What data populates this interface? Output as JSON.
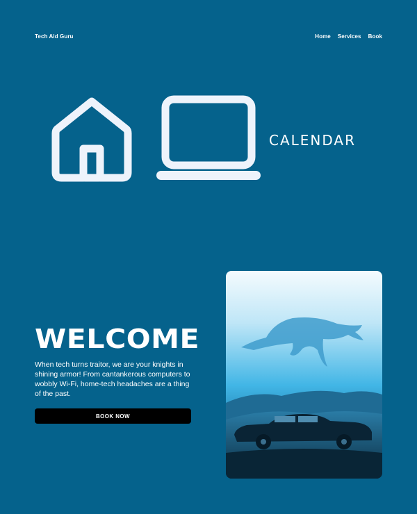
{
  "header": {
    "brand": "Tech Aid Guru",
    "nav": [
      "Home",
      "Services",
      "Book"
    ]
  },
  "icons": [
    "home-icon",
    "laptop-icon"
  ],
  "calendar_label": "CALENDAR",
  "hero": {
    "title": "WELCOME",
    "text": "When tech turns traitor, we are your knights in shining armor! From cantankerous computers to wobbly Wi-Fi, home-tech headaches are a thing of the past.",
    "button": "BOOK NOW"
  },
  "image": {
    "subject": "whale-over-vintage-car-illustration"
  },
  "colors": {
    "background": "#05628c",
    "text": "#ffffff",
    "icon": "#eef3fb",
    "button": "#000000"
  }
}
